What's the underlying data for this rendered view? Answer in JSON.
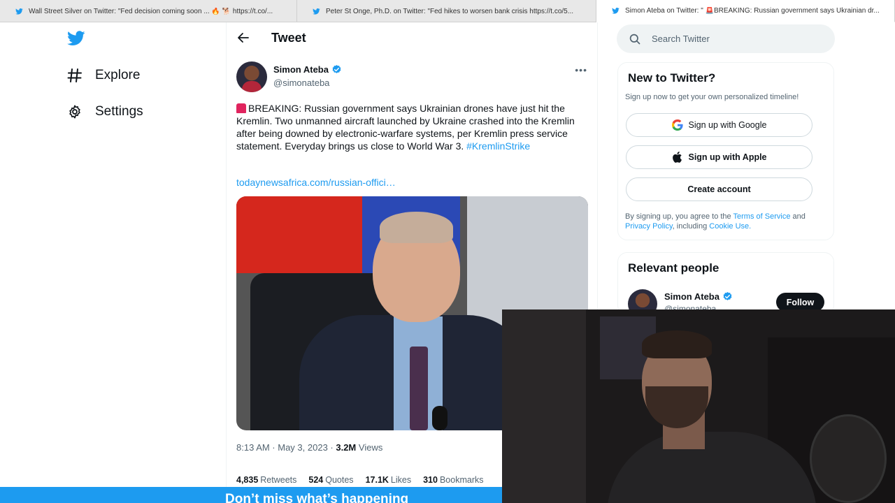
{
  "browser": {
    "tabs": [
      {
        "title": "Wall Street Silver on Twitter: \"Fed decision coming soon ... 🔥 🐕 https://t.co/...",
        "active": false
      },
      {
        "title": "Peter St Onge, Ph.D. on Twitter: \"Fed hikes to worsen bank crisis https://t.co/5...",
        "active": false
      },
      {
        "title": "Simon Ateba on Twitter: \" 🚨BREAKING: Russian government says Ukrainian dr...",
        "active": true
      }
    ]
  },
  "nav": {
    "logo_icon": "twitter-bird-icon",
    "items": [
      {
        "label": "Explore",
        "icon": "hashtag-icon"
      },
      {
        "label": "Settings",
        "icon": "gear-icon"
      }
    ]
  },
  "header": {
    "title": "Tweet",
    "back_icon": "arrow-left-icon"
  },
  "tweet": {
    "author_name": "Simon Ateba",
    "handle": "@simonateba",
    "text": "BREAKING: Russian government says Ukrainian drones have just hit the Kremlin. Two unmanned aircraft launched by Ukraine crashed into the Kremlin after being downed by electronic-warfare systems, per Kremlin press service statement. Everyday brings us close to World War 3.",
    "hashtag": "#KremlinStrike",
    "link": "todaynewsafrica.com/russian-offici…",
    "time": "8:13 AM · May 3, 2023 ·",
    "views_count": "3.2M",
    "views_label": "Views",
    "stats": [
      {
        "count": "4,835",
        "label": "Retweets"
      },
      {
        "count": "524",
        "label": "Quotes"
      },
      {
        "count": "17.1K",
        "label": "Likes"
      },
      {
        "count": "310",
        "label": "Bookmarks"
      }
    ]
  },
  "search": {
    "placeholder": "Search Twitter"
  },
  "new_to_twitter": {
    "title": "New to Twitter?",
    "subtitle": "Sign up now to get your own personalized timeline!",
    "google_label": "Sign up with Google",
    "apple_label": "Sign up with Apple",
    "create_label": "Create account",
    "legal_prefix": "By signing up, you agree to the",
    "terms": "Terms of Service",
    "and": "and",
    "privacy": "Privacy Policy",
    "including": ", including",
    "cookie": "Cookie Use."
  },
  "relevant": {
    "title": "Relevant people",
    "name": "Simon Ateba",
    "handle": "@simonateba",
    "follow_label": "Follow"
  },
  "banner": {
    "text": "Don’t miss what’s happening"
  },
  "colors": {
    "accent": "#1d9bf0",
    "text": "#0f1419",
    "muted": "#536471"
  }
}
